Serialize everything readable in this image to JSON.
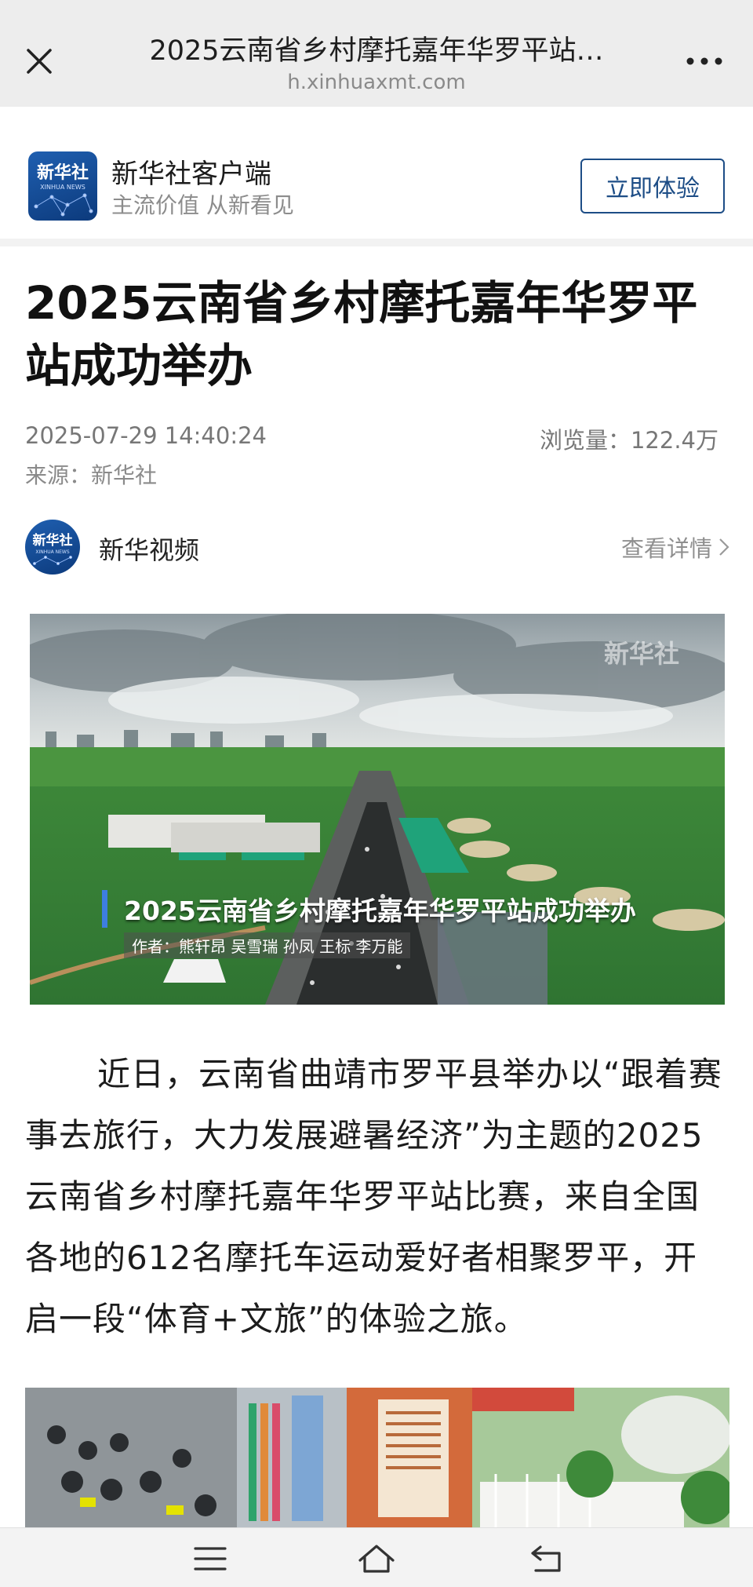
{
  "browser": {
    "title": "2025云南省乡村摩托嘉年华罗平站…",
    "url": "h.xinhuaxmt.com",
    "close_icon": "close-icon",
    "more_icon": "more-icon"
  },
  "banner": {
    "app_name": "新华社客户端",
    "slogan": "主流价值 从新看见",
    "try_button": "立即体验",
    "logo_text": "新华社",
    "logo_sub": "XINHUA NEWS"
  },
  "article": {
    "headline": "2025云南省乡村摩托嘉年华罗平站成功举办",
    "date": "2025-07-29 14:40:24",
    "views": "浏览量：122.4万",
    "source": "来源：新华社",
    "author_name": "新华视频",
    "author_detail": "查看详情",
    "video_caption": "2025云南省乡村摩托嘉年华罗平站成功举办",
    "video_credit": "作者：熊轩昂 吴雪瑞 孙凤 王标 李万能",
    "video_watermark": "新华社",
    "paragraph": "近日，云南省曲靖市罗平县举办以“跟着赛事去旅行，大力发展避暑经济”为主题的2025云南省乡村摩托嘉年华罗平站比赛，来自全国各地的612名摩托车运动爱好者相聚罗平，开启一段“体育+文旅”的体验之旅。"
  },
  "bottom_nav": {
    "menu_icon": "menu-icon",
    "home_icon": "home-icon",
    "back_icon": "back-icon"
  },
  "colors": {
    "brand_blue": "#1d4d86",
    "topbar_bg": "#ededed"
  }
}
